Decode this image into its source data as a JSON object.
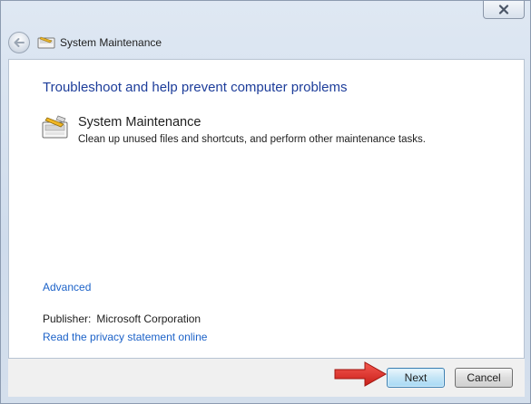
{
  "window": {
    "title": "System Maintenance",
    "close_icon": "close-icon",
    "back_icon": "back-arrow-icon",
    "title_icon": "system-maintenance-icon"
  },
  "content": {
    "heading": "Troubleshoot and help prevent computer problems",
    "task": {
      "icon": "system-maintenance-icon",
      "title": "System Maintenance",
      "description": "Clean up unused files and shortcuts, and perform other maintenance tasks."
    },
    "advanced_link": "Advanced",
    "publisher_label": "Publisher:",
    "publisher_value": "Microsoft Corporation",
    "privacy_link": "Read the privacy statement online"
  },
  "footer": {
    "next_label": "Next",
    "cancel_label": "Cancel",
    "annotation_icon": "red-arrow-pointer-icon"
  },
  "colors": {
    "heading": "#1d3d9a",
    "link": "#1c62c8",
    "arrow": "#e5302a",
    "next_border": "#3c7fb1"
  }
}
